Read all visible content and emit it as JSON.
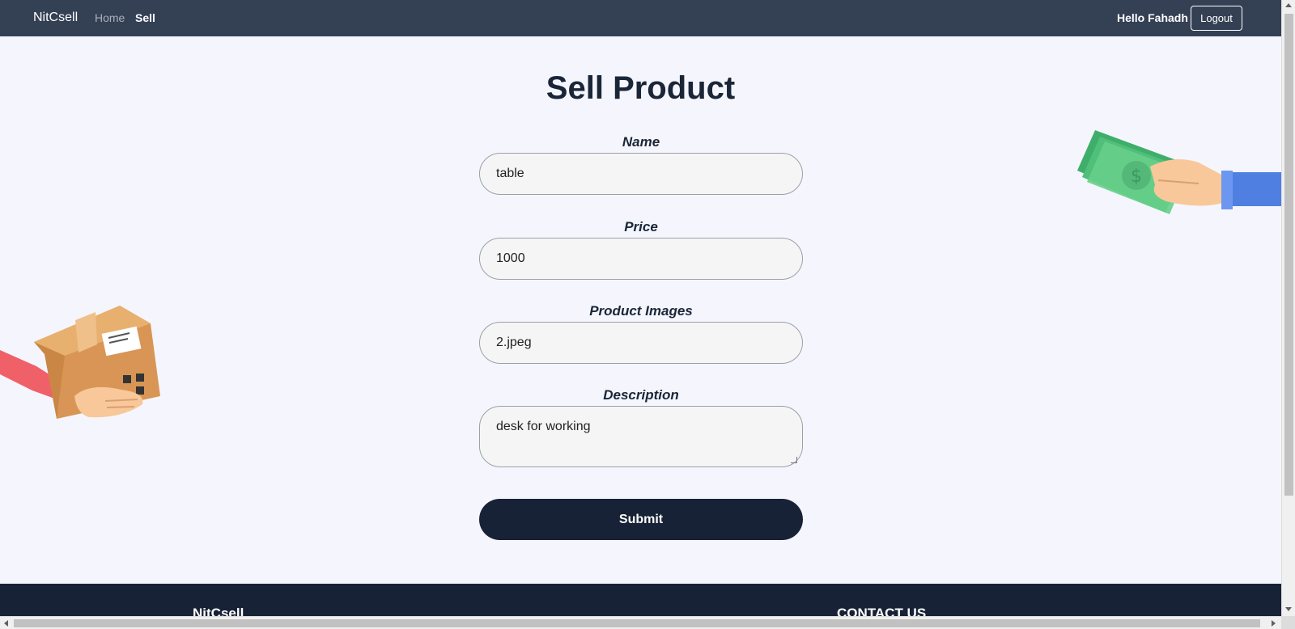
{
  "navbar": {
    "brand": "NitCsell",
    "links": [
      {
        "label": "Home",
        "active": false
      },
      {
        "label": "Sell",
        "active": true
      }
    ],
    "greeting": "Hello Fahadh",
    "logout_label": "Logout"
  },
  "page": {
    "title": "Sell Product"
  },
  "form": {
    "name": {
      "label": "Name",
      "value": "table"
    },
    "price": {
      "label": "Price",
      "value": "1000"
    },
    "images": {
      "label": "Product Images",
      "value": "2.jpeg"
    },
    "description": {
      "label": "Description",
      "value": "desk for working"
    },
    "submit_label": "Submit"
  },
  "footer": {
    "brand": "NitCsell",
    "contact_heading": "CONTACT US"
  },
  "colors": {
    "navbar_bg": "#344054",
    "page_bg": "#f5f6fd",
    "primary_dark": "#182236",
    "title_text": "#1a2638"
  },
  "icons": {
    "left_illustration": "package-box-hand-icon",
    "right_illustration": "cash-money-hand-icon"
  }
}
